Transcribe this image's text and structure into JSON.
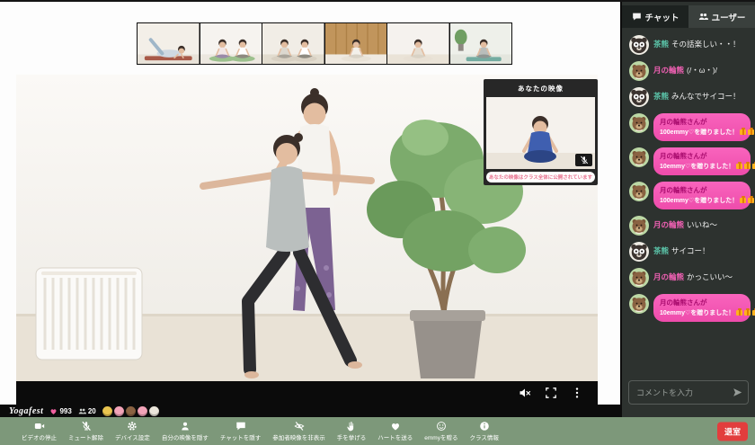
{
  "app": {
    "brand": "Yogafest",
    "hearts": "993",
    "viewers": "20",
    "participant_avatars": [
      "#e9c44f",
      "#f2a3b8",
      "#8a6242",
      "#f2a3b8",
      "#ebe6db"
    ]
  },
  "thumbnails": [
    {
      "name": "participant-video-1",
      "pose": "stretch",
      "wall": "#f3efe8",
      "floor": "#e8e2d8",
      "mat": "#a85948",
      "shirt": "#cfd8e2",
      "pants": "#9fb6c8"
    },
    {
      "name": "participant-video-2",
      "pose": "pair",
      "wall": "#f6f3ef",
      "floor": "#ece7df",
      "mat": "#9cc08d",
      "shirt": "#f2e6e6",
      "pants": "#9b8aa8"
    },
    {
      "name": "participant-video-3",
      "pose": "pair",
      "wall": "#f1ede6",
      "floor": "#e2dccf",
      "mat": "#d8d0c2",
      "shirt": "#dcd8cf",
      "pants": "#a9a49a"
    },
    {
      "name": "participant-video-4",
      "pose": "single",
      "wall": "#c1955c",
      "floor": "#efe9e0",
      "mat": "#e9e2d6",
      "shirt": "#f3f0ea",
      "pants": "#d8d2c6",
      "wood": true
    },
    {
      "name": "participant-video-5",
      "pose": "single",
      "wall": "#f5f2ee",
      "floor": "#eae3d7",
      "mat": "#e8e0d4",
      "shirt": "#e6ded2",
      "pants": "#d9d2c5"
    },
    {
      "name": "participant-video-6",
      "pose": "single-plant",
      "wall": "#eef0ea",
      "floor": "#e4e6de",
      "mat": "#74aca1",
      "shirt": "#b9bdbb",
      "pants": "#8f9592"
    }
  ],
  "pip": {
    "title": "あなたの映像",
    "notice": "あなたの映像はクラス全体に公開されています"
  },
  "stage_controls": [
    {
      "icon": "speaker-off"
    },
    {
      "icon": "fullscreen"
    },
    {
      "icon": "more-vertical"
    }
  ],
  "sidebar": {
    "tabs": [
      {
        "id": "chat",
        "label": "チャット",
        "icon": "chat-bubble",
        "active": true
      },
      {
        "id": "users",
        "label": "ユーザー",
        "icon": "users",
        "active": false
      }
    ],
    "messages": [
      {
        "type": "text",
        "user": "茶熊",
        "user_color": "#5bc4a9",
        "avatar": "panda-bear",
        "text": "その話楽しい・・！"
      },
      {
        "type": "text",
        "user": "月の輪熊",
        "user_color": "#f261b5",
        "avatar": "moon-bear",
        "text": "(/・ω・)/"
      },
      {
        "type": "text",
        "user": "茶熊",
        "user_color": "#5bc4a9",
        "avatar": "panda-bear",
        "text": "みんなでサイコー！"
      },
      {
        "type": "gift",
        "user": "月の輪熊さんが",
        "avatar": "moon-bear",
        "text": "100emmy♡を贈りました！",
        "gift_count": 3
      },
      {
        "type": "gift",
        "user": "月の輪熊さんが",
        "avatar": "moon-bear",
        "text": "10emmy♡を贈りました！",
        "gift_count": 3
      },
      {
        "type": "gift",
        "user": "月の輪熊さんが",
        "avatar": "moon-bear",
        "text": "100emmy♡を贈りました！",
        "gift_count": 3
      },
      {
        "type": "text",
        "user": "月の輪熊",
        "user_color": "#f261b5",
        "avatar": "moon-bear",
        "text": "いいね〜"
      },
      {
        "type": "text",
        "user": "茶熊",
        "user_color": "#5bc4a9",
        "avatar": "panda-bear",
        "text": "サイコー！"
      },
      {
        "type": "text",
        "user": "月の輪熊",
        "user_color": "#f261b5",
        "avatar": "moon-bear",
        "text": "かっこいい〜"
      },
      {
        "type": "gift",
        "user": "月の輪熊さんが",
        "avatar": "moon-bear",
        "text": "10emmy♡を贈りました！",
        "gift_count": 3
      }
    ],
    "input_placeholder": "コメントを入力"
  },
  "toolbar": {
    "items": [
      {
        "icon": "video-camera",
        "label": "ビデオの停止"
      },
      {
        "icon": "mic-off",
        "label": "ミュート解除"
      },
      {
        "icon": "gear",
        "label": "デバイス設定"
      },
      {
        "icon": "person",
        "label": "自分の映像を隠す"
      },
      {
        "icon": "chat-bubble",
        "label": "チャットを隠す"
      },
      {
        "icon": "eye-off",
        "label": "参加者映像を非表示"
      },
      {
        "icon": "raised-hand",
        "label": "手を挙げる"
      },
      {
        "icon": "heart",
        "label": "ハートを送る"
      },
      {
        "icon": "smiley",
        "label": "emmyを贈る"
      },
      {
        "icon": "info",
        "label": "クラス情報"
      }
    ],
    "leave_label": "退室"
  },
  "colors": {
    "toolbar_green": "#7d987a",
    "leave_red": "#e23d3d",
    "gift_bubble_pink": "#f05ab4",
    "heart_pink": "#f0609f",
    "sidebar_dark": "#2d322f"
  }
}
